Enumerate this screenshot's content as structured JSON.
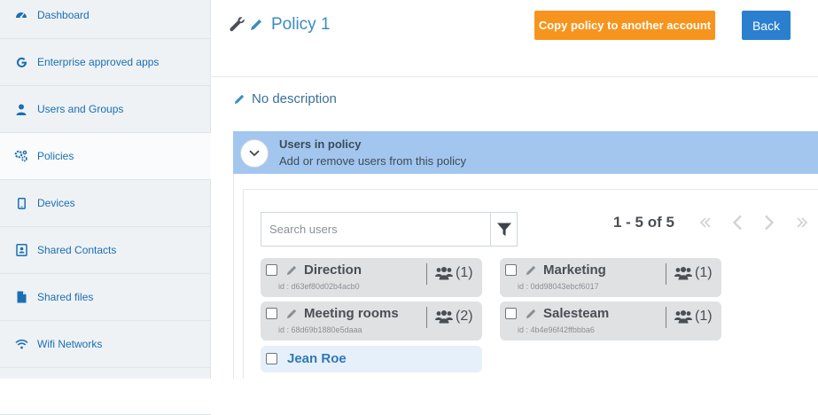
{
  "sidebar": {
    "items": [
      {
        "label": "Dashboard",
        "icon": "dashboard-icon"
      },
      {
        "label": "Enterprise approved apps",
        "icon": "google-icon"
      },
      {
        "label": "Users and Groups",
        "icon": "user-icon"
      },
      {
        "label": "Policies",
        "icon": "gears-icon"
      },
      {
        "label": "Devices",
        "icon": "device-icon"
      },
      {
        "label": "Shared Contacts",
        "icon": "contacts-icon"
      },
      {
        "label": "Shared files",
        "icon": "file-icon"
      },
      {
        "label": "Wifi Networks",
        "icon": "wifi-icon"
      }
    ],
    "active_item": "Policies"
  },
  "header": {
    "title": "Policy 1",
    "copy_button": "Copy policy to another account",
    "back_button": "Back"
  },
  "description": "No description",
  "users_panel": {
    "title": "Users in policy",
    "subtitle": "Add or remove users from this policy",
    "search_placeholder": "Search users",
    "pagination": "1 - 5 of 5",
    "groups": [
      {
        "name": "Direction",
        "id": "id : d63ef80d02b4acb0",
        "count": "(1)"
      },
      {
        "name": "Marketing",
        "id": "id : 0dd98043ebcf6017",
        "count": "(1)"
      },
      {
        "name": "Meeting rooms",
        "id": "id : 68d69b1880e5daaa",
        "count": "(2)"
      },
      {
        "name": "Salesteam",
        "id": "id : 4b4e96f42ffbbba6",
        "count": "(1)"
      }
    ],
    "users": [
      {
        "name": "Jean Roe"
      }
    ]
  },
  "colors": {
    "accent_orange": "#f7941d",
    "accent_blue": "#2a7fcf",
    "panel_header": "#a3c6ef",
    "link_blue": "#1a6fb4"
  }
}
